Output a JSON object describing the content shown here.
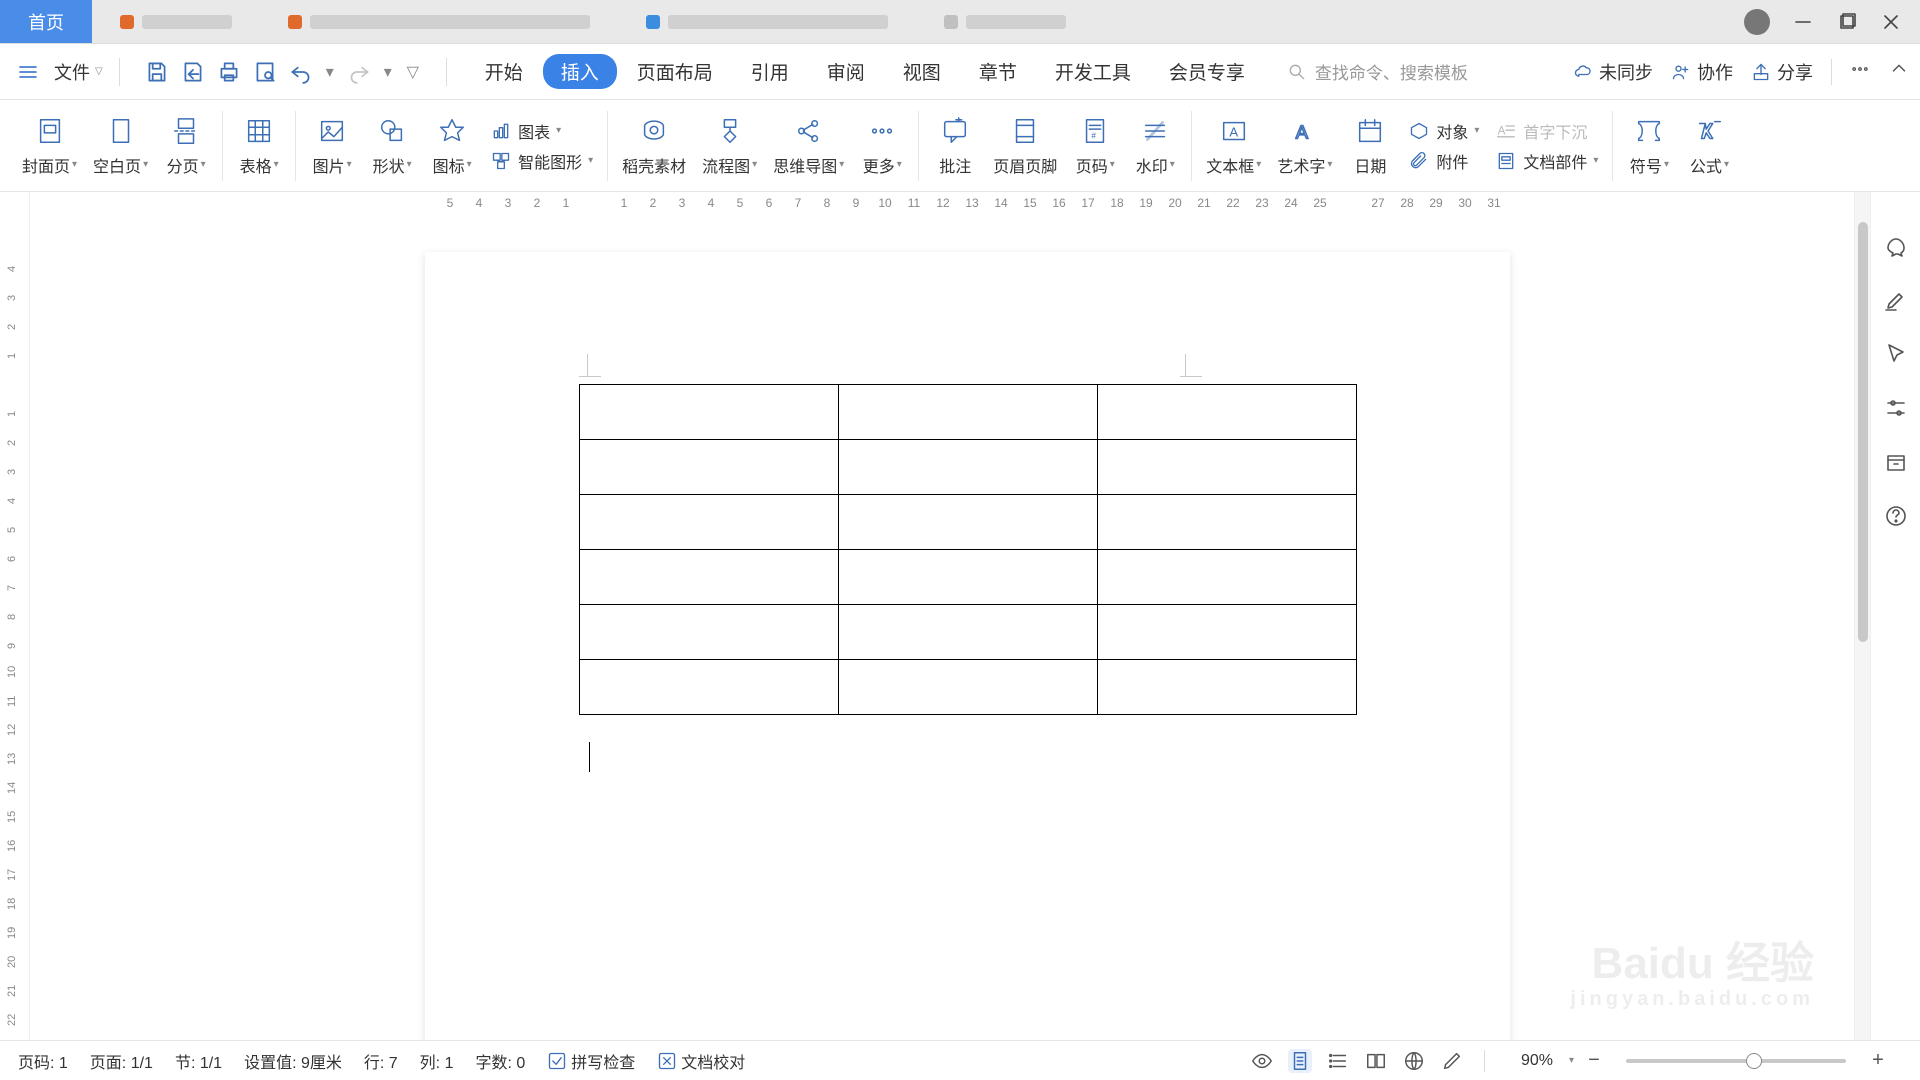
{
  "titlebar": {
    "tabs": [
      {
        "label": "首页",
        "active": true
      },
      {
        "label": "",
        "blurred": true,
        "dotColor": "#e06a2b",
        "blurWidth": 90
      },
      {
        "label": "",
        "blurred": true,
        "dotColor": "#e06a2b",
        "blurWidth": 280
      },
      {
        "label": "",
        "blurred": true,
        "dotColor": "#3c8de0",
        "blurWidth": 220
      },
      {
        "label": "",
        "blurred": true,
        "dotColor": "#c0c0c0",
        "blurWidth": 100
      }
    ]
  },
  "quickbar": {
    "file_label": "文件",
    "main_tabs": [
      "开始",
      "插入",
      "页面布局",
      "引用",
      "审阅",
      "视图",
      "章节",
      "开发工具",
      "会员专享"
    ],
    "active_main_tab": "插入",
    "search_placeholder": "查找命令、搜索模板",
    "right": {
      "unsync": "未同步",
      "collab": "协作",
      "share": "分享"
    }
  },
  "ribbon": {
    "items": [
      {
        "label": "封面页",
        "dd": true
      },
      {
        "label": "空白页",
        "dd": true
      },
      {
        "label": "分页",
        "dd": true
      },
      {
        "label": "表格",
        "dd": true
      },
      {
        "label": "图片",
        "dd": true
      },
      {
        "label": "形状",
        "dd": true
      },
      {
        "label": "图标",
        "dd": true
      }
    ],
    "group_chart": {
      "chart": "图表",
      "smart": "智能图形"
    },
    "items2": [
      {
        "label": "稻壳素材"
      },
      {
        "label": "流程图",
        "dd": true
      },
      {
        "label": "思维导图",
        "dd": true
      },
      {
        "label": "更多",
        "dd": true
      }
    ],
    "items3": [
      {
        "label": "批注"
      },
      {
        "label": "页眉页脚"
      },
      {
        "label": "页码",
        "dd": true
      },
      {
        "label": "水印",
        "dd": true
      }
    ],
    "items4": [
      {
        "label": "文本框",
        "dd": true
      },
      {
        "label": "艺术字",
        "dd": true
      },
      {
        "label": "日期"
      }
    ],
    "group_obj": {
      "object": "对象",
      "dropcap": "首字下沉",
      "attach": "附件",
      "docparts": "文档部件"
    },
    "items5": [
      {
        "label": "符号",
        "dd": true
      },
      {
        "label": "公式",
        "dd": true
      }
    ]
  },
  "ruler_h": [
    "5",
    "4",
    "3",
    "2",
    "1",
    "",
    "1",
    "2",
    "3",
    "4",
    "5",
    "6",
    "7",
    "8",
    "9",
    "10",
    "11",
    "12",
    "13",
    "14",
    "15",
    "16",
    "17",
    "18",
    "19",
    "20",
    "21",
    "22",
    "23",
    "24",
    "25",
    "",
    "27",
    "28",
    "29",
    "30",
    "31"
  ],
  "ruler_v": [
    "4",
    "3",
    "2",
    "1",
    "",
    "1",
    "2",
    "3",
    "4",
    "5",
    "6",
    "7",
    "8",
    "9",
    "10",
    "11",
    "12",
    "13",
    "14",
    "15",
    "16",
    "17",
    "18",
    "19",
    "20",
    "21",
    "22"
  ],
  "document": {
    "table": {
      "rows": 6,
      "cols": 3
    }
  },
  "statusbar": {
    "page_no": "页码: 1",
    "page_of": "页面: 1/1",
    "section": "节: 1/1",
    "setting": "设置值: 9厘米",
    "line": "行: 7",
    "col": "列: 1",
    "words": "字数: 0",
    "spell": "拼写检查",
    "proof": "文档校对",
    "zoom": "90%"
  },
  "watermark": {
    "main": "Baidu 经验",
    "sub": "jingyan.baidu.com"
  }
}
